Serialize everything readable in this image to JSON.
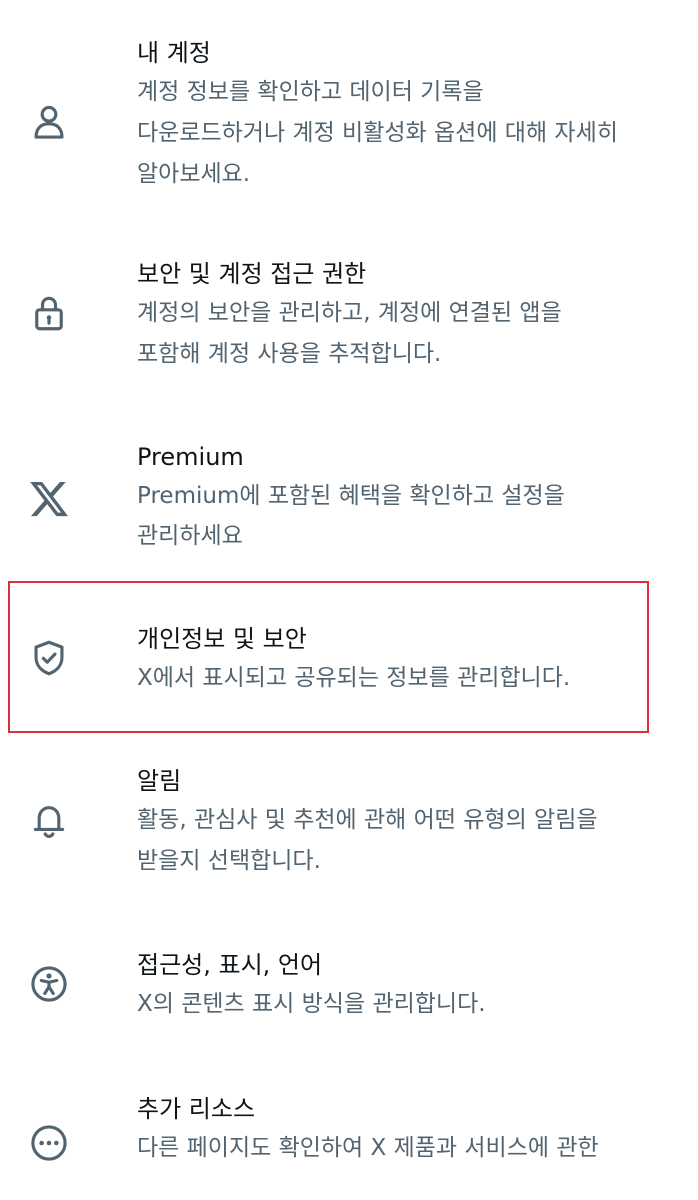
{
  "settings": {
    "items": [
      {
        "id": "account",
        "icon": "person-icon",
        "title": "내 계정",
        "desc": [
          "계정 정보를 확인하고 데이터 기록을",
          "다운로드하거나 계정 비활성화 옵션에 대해 자세히",
          "알아보세요."
        ]
      },
      {
        "id": "security",
        "icon": "lock-icon",
        "title": "보안 및 계정 접근 권한",
        "desc": [
          "계정의 보안을 관리하고, 계정에 연결된 앱을",
          "포함해 계정 사용을 추적합니다."
        ]
      },
      {
        "id": "premium",
        "icon": "x-logo-icon",
        "title": "Premium",
        "desc": [
          "Premium에 포함된 혜택을 확인하고 설정을",
          "관리하세요"
        ]
      },
      {
        "id": "privacy",
        "icon": "shield-check-icon",
        "title": "개인정보 및 보안",
        "desc": [
          "X에서 표시되고 공유되는 정보를 관리합니다."
        ]
      },
      {
        "id": "notifications",
        "icon": "bell-icon",
        "title": "알림",
        "desc": [
          "활동, 관심사 및 추천에 관해 어떤 유형의 알림을",
          "받을지 선택합니다."
        ]
      },
      {
        "id": "accessibility",
        "icon": "accessibility-icon",
        "title": "접근성, 표시, 언어",
        "desc": [
          "X의 콘텐츠 표시 방식을 관리합니다."
        ]
      },
      {
        "id": "resources",
        "icon": "more-icon",
        "title": "추가 리소스",
        "desc": [
          "다른 페이지도 확인하여 X 제품과 서비스에 관한"
        ]
      }
    ]
  },
  "colors": {
    "title": "#0f1419",
    "description": "#536471",
    "icon": "#536471",
    "highlight": "#d9313c"
  }
}
